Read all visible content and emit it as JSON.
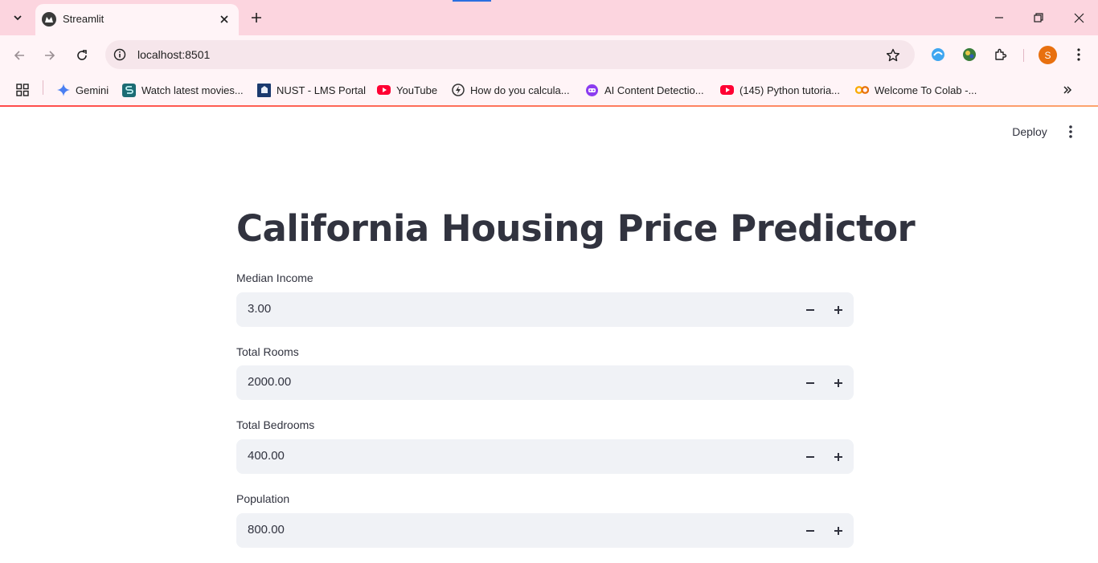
{
  "browser": {
    "tab_title": "Streamlit",
    "url": "localhost:8501",
    "profile_initial": "S",
    "bookmarks": [
      {
        "label": "Gemini",
        "icon": "gemini-icon"
      },
      {
        "label": "Watch latest movies...",
        "icon": "movies-icon"
      },
      {
        "label": "NUST - LMS Portal",
        "icon": "nust-icon"
      },
      {
        "label": "YouTube",
        "icon": "youtube-icon"
      },
      {
        "label": "How do you calcula...",
        "icon": "perplexity-icon"
      },
      {
        "label": "AI Content Detectio...",
        "icon": "ai-detector-icon"
      },
      {
        "label": "(145) Python tutoria...",
        "icon": "youtube-icon"
      },
      {
        "label": "Welcome To Colab -...",
        "icon": "colab-icon"
      }
    ]
  },
  "app": {
    "deploy_label": "Deploy",
    "title": "California Housing Price Predictor",
    "inputs": [
      {
        "label": "Median Income",
        "value": "3.00"
      },
      {
        "label": "Total Rooms",
        "value": "2000.00"
      },
      {
        "label": "Total Bedrooms",
        "value": "400.00"
      },
      {
        "label": "Population",
        "value": "800.00"
      }
    ]
  },
  "colors": {
    "tabstrip": "#fcd5df",
    "toolbar": "#fff4f7",
    "input_bg": "#f0f2f6",
    "text": "#31333f",
    "accent": "#ff4b4b"
  }
}
